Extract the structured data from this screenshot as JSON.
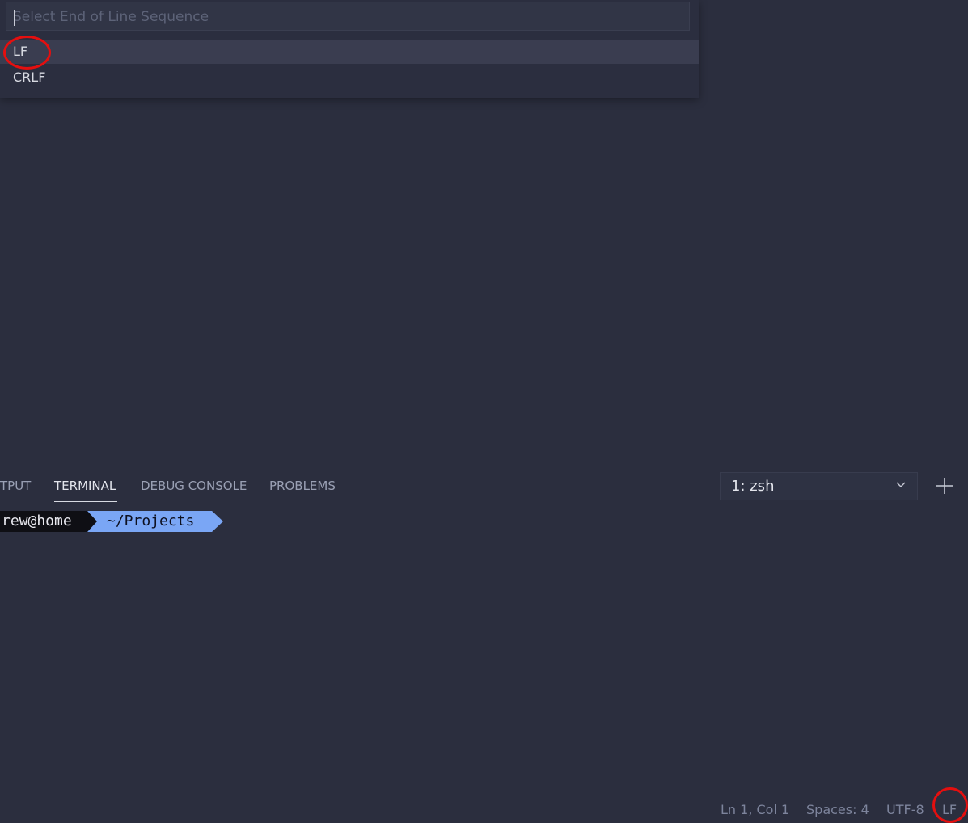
{
  "quick_pick": {
    "placeholder": "Select End of Line Sequence",
    "items": [
      {
        "label": "LF",
        "selected": true
      },
      {
        "label": "CRLF",
        "selected": false
      }
    ]
  },
  "panel": {
    "tabs": [
      {
        "label": "TPUT",
        "active": false
      },
      {
        "label": "TERMINAL",
        "active": true
      },
      {
        "label": "DEBUG CONSOLE",
        "active": false
      },
      {
        "label": "PROBLEMS",
        "active": false
      }
    ],
    "terminal_select": "1: zsh"
  },
  "terminal": {
    "user_host": "rew@home",
    "path": "~/Projects"
  },
  "status_bar": {
    "position": "Ln 1, Col 1",
    "indentation": "Spaces: 4",
    "encoding": "UTF-8",
    "eol": "LF"
  },
  "colors": {
    "background": "#2b2e3e",
    "highlight_ring": "#e40f0f",
    "prompt_path_bg": "#7aa6f5"
  }
}
